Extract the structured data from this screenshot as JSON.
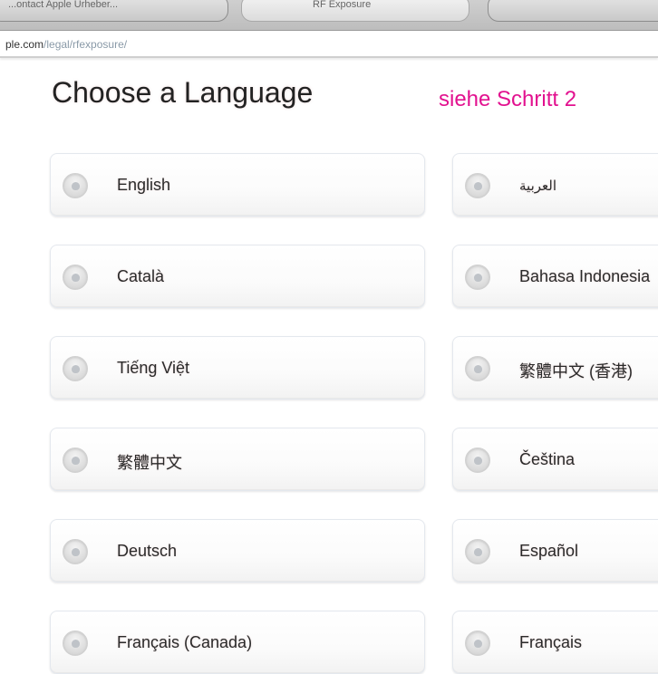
{
  "browser": {
    "tabs": [
      {
        "label": "...ontact Apple Urheber..."
      },
      {
        "label": "RF Exposure"
      },
      {
        "label": ""
      }
    ],
    "url": {
      "host": "ple.com",
      "path": "/legal/rfexposure/"
    }
  },
  "page": {
    "heading": "Choose a Language",
    "annotation": "siehe Schritt 2",
    "annotation_color": "#e2118f"
  },
  "languages": {
    "col1": [
      {
        "label": "English"
      },
      {
        "label": "Català"
      },
      {
        "label": "Tiếng Việt"
      },
      {
        "label": "繁體中文"
      },
      {
        "label": "Deutsch"
      },
      {
        "label": "Français (Canada)"
      }
    ],
    "col2": [
      {
        "label": "العربية"
      },
      {
        "label": "Bahasa Indonesia"
      },
      {
        "label": "繁體中文 (香港)"
      },
      {
        "label": "Čeština"
      },
      {
        "label": "Español"
      },
      {
        "label": "Français"
      }
    ]
  }
}
